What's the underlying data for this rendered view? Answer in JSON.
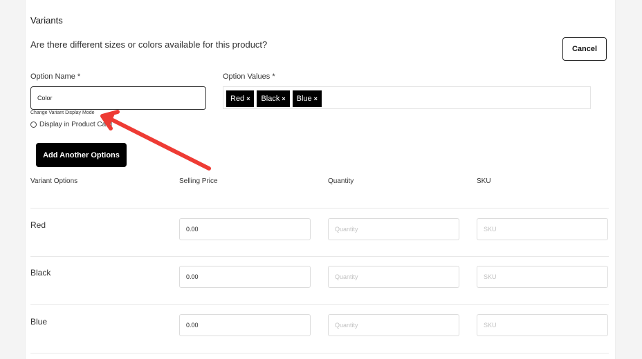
{
  "section": {
    "title": "Variants",
    "question": "Are there different sizes or colors available for this product?"
  },
  "cancel_label": "Cancel",
  "option_name": {
    "label": "Option Name *",
    "value": "Color",
    "change_mode_label": "Change Variant Display Mode",
    "radio_label": "Display in Product Card"
  },
  "option_values": {
    "label": "Option Values *",
    "chips": [
      "Red",
      "Black",
      "Blue"
    ],
    "remove_glyph": "×"
  },
  "add_button_label": "Add Another Options",
  "table": {
    "headers": [
      "Variant Options",
      "Selling Price",
      "Quantity",
      "SKU"
    ],
    "rows": [
      {
        "name": "Red",
        "price": "0.00",
        "quantity_placeholder": "Quantity",
        "sku_placeholder": "SKU"
      },
      {
        "name": "Black",
        "price": "0.00",
        "quantity_placeholder": "Quantity",
        "sku_placeholder": "SKU"
      },
      {
        "name": "Blue",
        "price": "0.00",
        "quantity_placeholder": "Quantity",
        "sku_placeholder": "SKU"
      }
    ]
  },
  "colors": {
    "annotation_arrow": "#ee3b34",
    "chip_bg": "#000000",
    "button_bg": "#000000"
  }
}
